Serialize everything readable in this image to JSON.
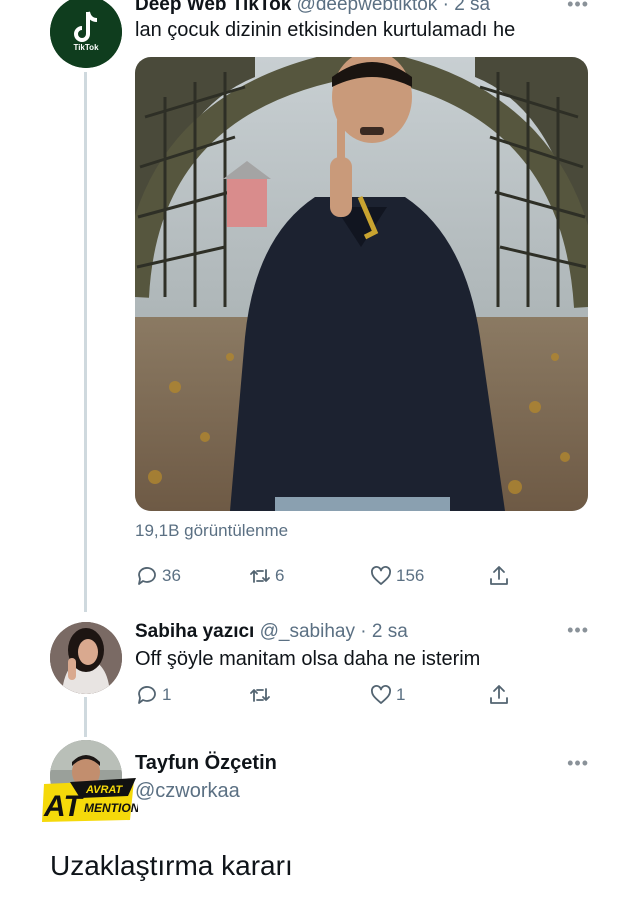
{
  "tweet1": {
    "name": "Deep Web TikTok",
    "handle": "@deepwebtiktok",
    "time_sep": " · ",
    "time": "2 sa",
    "text": "lan çocuk dizinin etkisinden kurtulamadı he",
    "avatar_label": "TikTok",
    "views": "19,1B görüntülenme",
    "replies": "36",
    "retweets": "6",
    "likes": "156"
  },
  "tweet2": {
    "name": "Sabiha yazıcı",
    "handle": "@_sabihay",
    "time_sep": " · ",
    "time": "2 sa",
    "text": "Off şöyle manitam olsa daha ne isterim",
    "replies": "1",
    "retweets": "",
    "likes": "1"
  },
  "tweet3": {
    "name": "Tayfun Özçetin",
    "handle": "@czworkaa",
    "text": "Uzaklaştırma kararı"
  },
  "watermark": {
    "line1": "AVRAT",
    "line2": "MENTION",
    "prefix": "AT"
  },
  "more_label": "•••",
  "colors": {
    "text": "#0f1419",
    "secondary": "#5b7083",
    "thread_line": "#cfd9de",
    "badge_yellow": "#f5d90a"
  }
}
